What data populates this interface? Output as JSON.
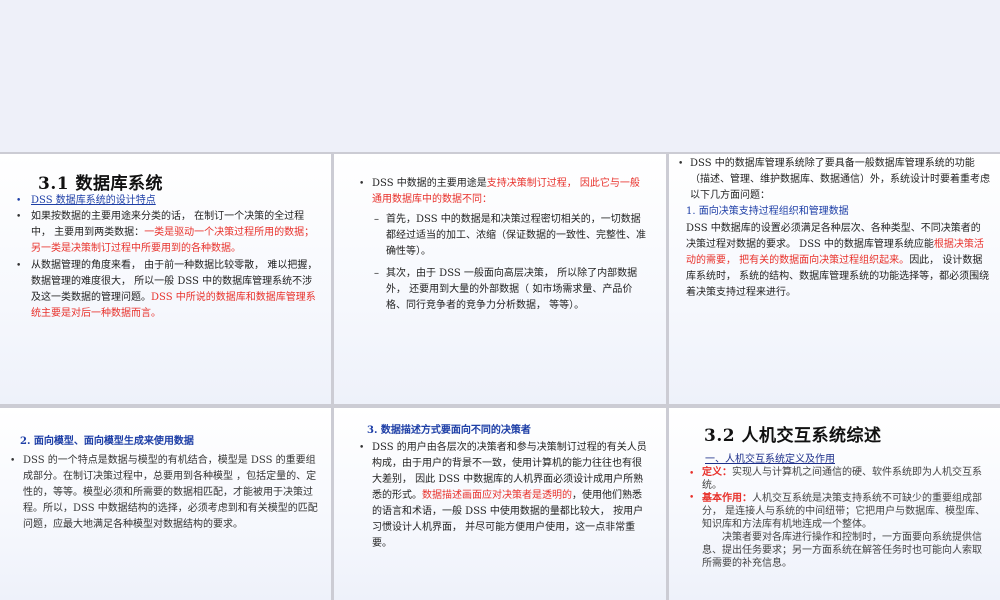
{
  "s1": {
    "title": "3.1  数据库系统",
    "link": "DSS 数据库系统的设计特点",
    "p1a": "如果按数据的主要用途来分类的话，  在制订一个决策的全过程中，  主要用到两类数据：",
    "p1b": "一类是驱动一个决策过程所用的数据；另一类是决策制订过程中所要用到的各种数据。",
    "p2a": "从数据管理的角度来看，  由于前一种数据比较零散，  难以把握，  数据管理的难度很大，  所以一般 DSS 中的数据库管理系统不涉及这一类数据的管理问题。",
    "p2b": "DSS 中所说的数据库和数据库管理系统主要是对后一种数据而言。"
  },
  "s2": {
    "p1a": "DSS 中数据的主要用途是",
    "p1b": "支持决策制订过程，  因此它与一般通用数据库中的数据不同：",
    "d1": "首先，DSS 中的数据是和决策过程密切相关的，一切数据都经过适当的加工、浓缩（保证数据的一致性、完整性、准确性等）。",
    "d2": "其次，由于 DSS 一般面向高层决策，  所以除了内部数据外，  还要用到大量的外部数据（ 如市场需求量、产品价格、同行竞争者的竞争力分析数据，  等等）。"
  },
  "s3": {
    "p1": "DSS 中的数据库管理系统除了要具备一般数据库管理系统的功能（描述、管理、维护数据库、数据通信）外，系统设计时要着重考虑以下几方面问题：",
    "sub": "1. 面向决策支持过程组织和管理数据",
    "body_a": "DSS 中数据库的设置必须满足各种层次、各种类型、不同决策者的决策过程对数据的要求。 DSS 中的数据库管理系统应能",
    "body_b": "根据决策活动的需要，  把有关的数据面向决策过程组织起来。",
    "body_c": "因此，  设计数据库系统时，  系统的结构、数据库管理系统的功能选择等，都必须围绕着决策支持过程来进行。"
  },
  "s4": {
    "sub": "2. 面向模型、面向模型生成来使用数据",
    "p1": "DSS 的一个特点是数据与模型的有机结合，模型是  DSS 的重要组成部分。在制订决策过程中，总要用到各种模型 ，包括定量的、定性的，等等。模型必须和所需要的数据相匹配，才能被用于决策过程。所以，DSS 中数据结构的选择，必须考虑到和有关模型的匹配问题，应最大地满足各种模型对数据结构的要求。"
  },
  "s5": {
    "sub": "3. 数据描述方式要面向不同的决策者",
    "p1a": "DSS 的用户由各层次的决策者和参与决策制订过程的有关人员构成，由于用户的背景不一致，使用计算机的能力往往也有很大差别，  因此 DSS 中数据库的人机界面必须设计成用户所熟悉的形式。",
    "p1b": "数据描述画面应对决策者是透明的",
    "p1c": "，使用他们熟悉的语言和术语，一般  DSS  中使用数据的量都比较大，  按用户习惯设计人机界面，  并尽可能方便用户使用，这一点非常重要。"
  },
  "s6": {
    "title": "3.2  人机交互系统综述",
    "link": "一、人机交互系统定义及作用",
    "d_label": "定义：",
    "d_text": "实现人与计算机之间通信的硬、软件系统即为人机交互系统。",
    "r_label": "基本作用：",
    "r_text": "人机交互系统是决策支持系统不可缺少的重要组成部分，  是连接人与系统的中间纽带；它把用户与数据库、模型库、知识库和方法库有机地连成一个整体。",
    "r_text2": "决策者要对各库进行操作和控制时，一方面要向系统提供信息、提出任务要求；另一方面系统在解答任务时也可能向人索取所需要的补充信息。"
  }
}
